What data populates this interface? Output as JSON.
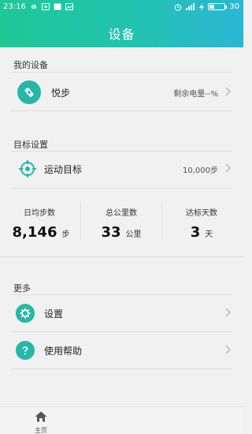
{
  "status_bar": {
    "time": "23:16",
    "battery_level": "30"
  },
  "header": {
    "title": "设备"
  },
  "my_devices": {
    "section_label": "我的设备",
    "device": {
      "name": "悦步",
      "battery_text": "剩余电量--%"
    }
  },
  "goals": {
    "section_label": "目标设置",
    "exercise_goal": {
      "label": "运动目标",
      "value": "10,000步"
    },
    "stats": [
      {
        "title": "日均步数",
        "value": "8,146",
        "unit": "步"
      },
      {
        "title": "总公里数",
        "value": "33",
        "unit": "公里"
      },
      {
        "title": "达标天数",
        "value": "3",
        "unit": "天"
      }
    ]
  },
  "more": {
    "section_label": "更多",
    "items": [
      {
        "label": "设置"
      },
      {
        "label": "使用帮助"
      }
    ]
  },
  "bottom_nav": {
    "home_label": "主页"
  },
  "colors": {
    "accent": "#27b7a6",
    "header_start": "#1fc796",
    "header_end": "#2bb6d6"
  }
}
